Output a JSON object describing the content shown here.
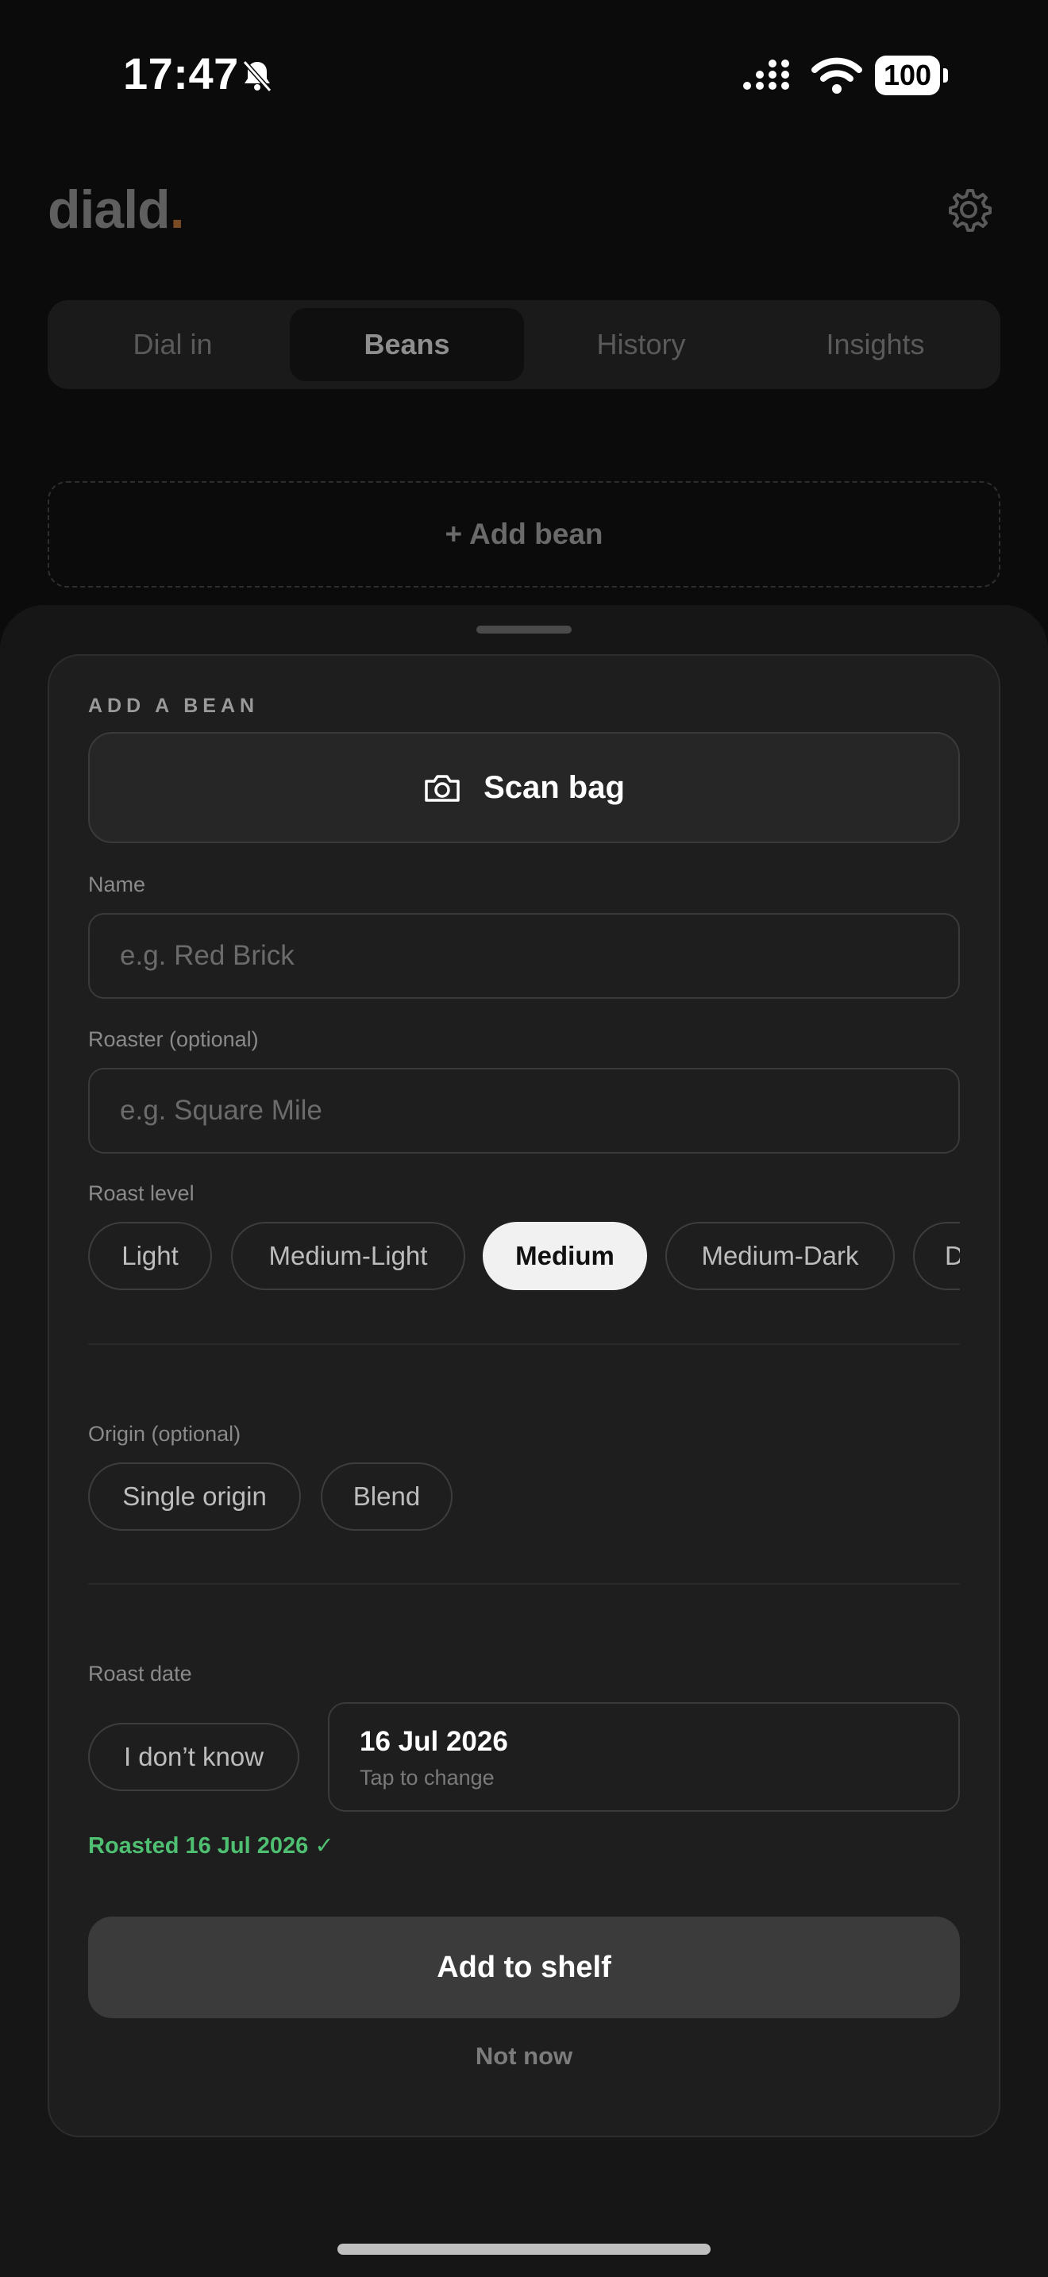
{
  "status_bar": {
    "time": "17:47",
    "battery": "100"
  },
  "header": {
    "logo": "diald",
    "logo_dot": "."
  },
  "tabs": [
    {
      "label": "Dial in",
      "active": false
    },
    {
      "label": "Beans",
      "active": true
    },
    {
      "label": "History",
      "active": false
    },
    {
      "label": "Insights",
      "active": false
    }
  ],
  "add_bean_label": "+ Add bean",
  "form": {
    "section_title": "ADD A BEAN",
    "scan_label": "Scan bag",
    "name": {
      "label": "Name",
      "placeholder": "e.g. Red Brick",
      "value": ""
    },
    "roaster": {
      "label": "Roaster (optional)",
      "placeholder": "e.g. Square Mile",
      "value": ""
    },
    "roast_level": {
      "label": "Roast level",
      "options": [
        "Light",
        "Medium-Light",
        "Medium",
        "Medium-Dark",
        "Dark"
      ],
      "selected": "Medium"
    },
    "origin": {
      "label": "Origin (optional)",
      "options": [
        "Single origin",
        "Blend"
      ]
    },
    "roast_date": {
      "label": "Roast date",
      "unknown_label": "I don’t know",
      "date": "16 Jul 2026",
      "hint": "Tap to change",
      "confirmation": "Roasted 16 Jul 2026 ✓"
    },
    "primary_label": "Add to shelf",
    "secondary_label": "Not now"
  },
  "colors": {
    "background": "#0b0b0b",
    "sheet": "#161616",
    "card": "#1e1e1e",
    "accent_green": "#4fbf72",
    "logo_dot": "#7a4a22"
  }
}
